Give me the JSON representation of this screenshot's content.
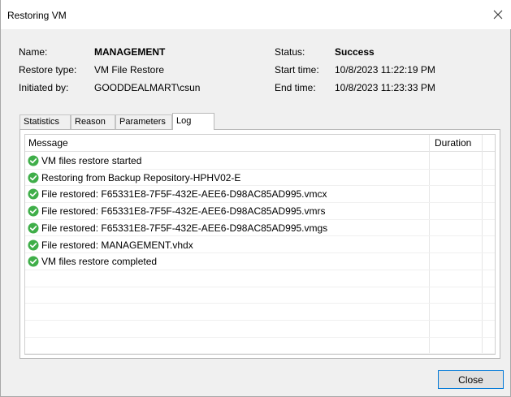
{
  "window": {
    "title": "Restoring VM"
  },
  "details": {
    "name_label": "Name:",
    "name_value": "MANAGEMENT",
    "restore_type_label": "Restore type:",
    "restore_type_value": "VM File Restore",
    "initiated_by_label": "Initiated by:",
    "initiated_by_value": "GOODDEALMART\\csun",
    "status_label": "Status:",
    "status_value": "Success",
    "start_time_label": "Start time:",
    "start_time_value": "10/8/2023 11:22:19 PM",
    "end_time_label": "End time:",
    "end_time_value": "10/8/2023 11:23:33 PM"
  },
  "tabs": [
    {
      "label": "Statistics"
    },
    {
      "label": "Reason"
    },
    {
      "label": "Parameters"
    },
    {
      "label": "Log",
      "active": true
    }
  ],
  "log": {
    "columns": {
      "message": "Message",
      "duration": "Duration"
    },
    "rows": [
      {
        "message": "VM files restore started",
        "status": "success"
      },
      {
        "message": "Restoring from Backup Repository-HPHV02-E",
        "status": "success"
      },
      {
        "message": "File restored: F65331E8-7F5F-432E-AEE6-D98AC85AD995.vmcx",
        "status": "success"
      },
      {
        "message": "File restored: F65331E8-7F5F-432E-AEE6-D98AC85AD995.vmrs",
        "status": "success"
      },
      {
        "message": "File restored: F65331E8-7F5F-432E-AEE6-D98AC85AD995.vmgs",
        "status": "success"
      },
      {
        "message": "File restored: MANAGEMENT.vhdx",
        "status": "success"
      },
      {
        "message": "VM files restore completed",
        "status": "success"
      }
    ],
    "success_icon": "green-check-circle-icon",
    "success_color": "#3fae49"
  },
  "buttons": {
    "close_label": "Close"
  },
  "icons": {
    "close": "close-x-icon"
  }
}
